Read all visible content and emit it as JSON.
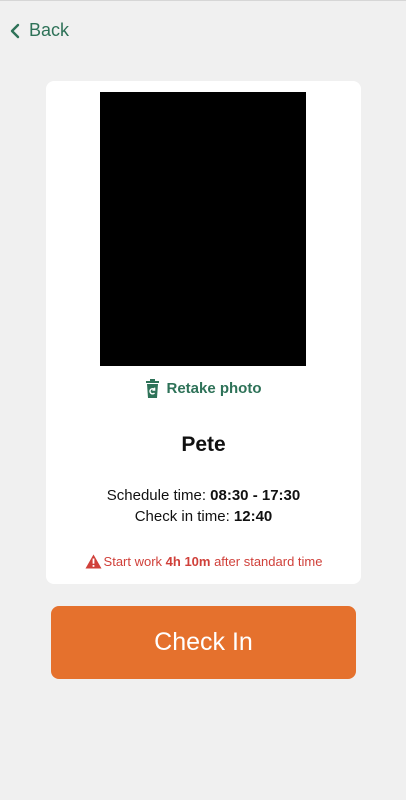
{
  "nav": {
    "back_label": "Back"
  },
  "card": {
    "retake_label": "Retake photo",
    "name": "Pete",
    "schedule_label": "Schedule time: ",
    "schedule_value": "08:30 - 17:30",
    "checkin_label": "Check in time: ",
    "checkin_value": "12:40",
    "warning_prefix": "Start work ",
    "warning_value": "4h 10m",
    "warning_suffix": " after standard time"
  },
  "actions": {
    "checkin_label": "Check In"
  },
  "icons": {
    "back": "chevron-left-icon",
    "retake": "trash-icon",
    "warning": "warning-triangle-icon"
  },
  "colors": {
    "accent_green": "#2e7258",
    "primary_orange": "#e5712d",
    "warning_red": "#d0403a",
    "background": "#f0f0f0",
    "card": "#ffffff"
  }
}
